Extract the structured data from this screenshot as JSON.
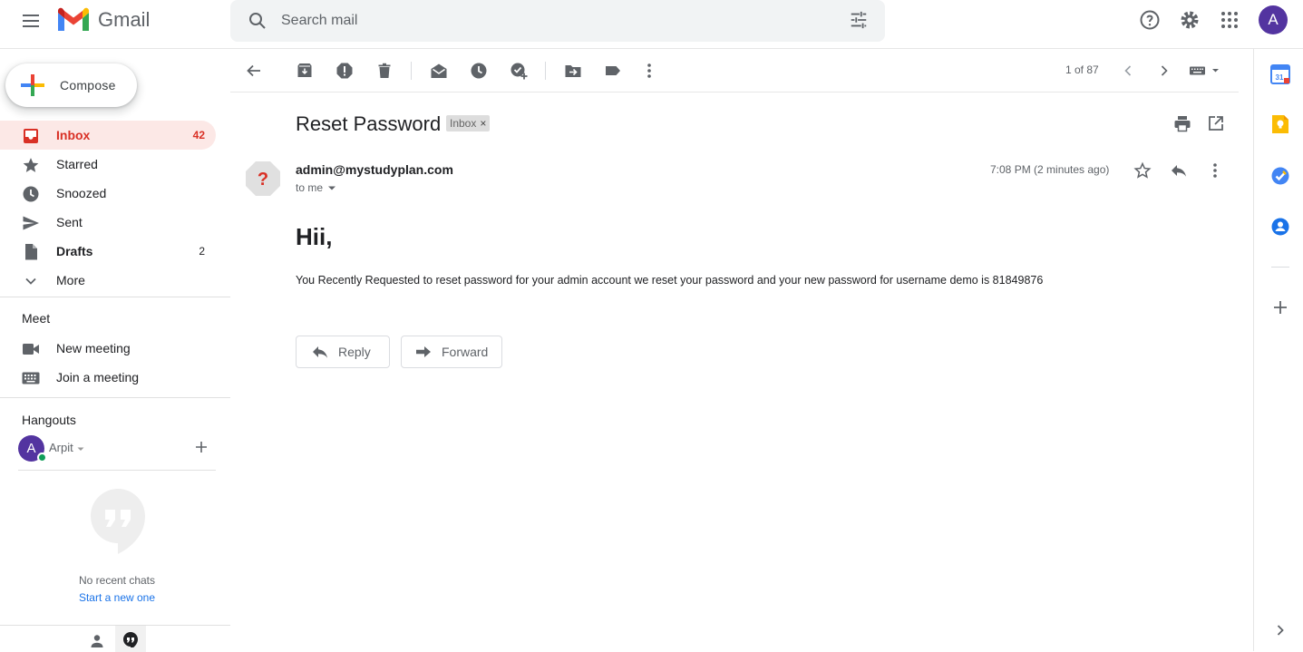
{
  "app": {
    "name": "Gmail"
  },
  "search": {
    "placeholder": "Search mail"
  },
  "account": {
    "initial": "A"
  },
  "compose": {
    "label": "Compose"
  },
  "nav": {
    "items": [
      {
        "label": "Inbox",
        "count": "42"
      },
      {
        "label": "Starred",
        "count": ""
      },
      {
        "label": "Snoozed",
        "count": ""
      },
      {
        "label": "Sent",
        "count": ""
      },
      {
        "label": "Drafts",
        "count": "2"
      },
      {
        "label": "More",
        "count": ""
      }
    ]
  },
  "meet": {
    "title": "Meet",
    "new_meeting": "New meeting",
    "join_meeting": "Join a meeting"
  },
  "hangouts": {
    "title": "Hangouts",
    "user_initial": "A",
    "user_name": "Arpit",
    "no_chats": "No recent chats",
    "start_new": "Start a new one"
  },
  "toolbar": {
    "pager": "1 of 87"
  },
  "message": {
    "subject": "Reset Password",
    "label": "Inbox",
    "label_close": "×",
    "sender": "admin@mystudyplan.com",
    "recipient": "to me",
    "time": "7:08 PM (2 minutes ago)",
    "greeting": "Hii,",
    "body": "You Recently Requested to reset password for your admin account we reset your password and your new password for username demo is 81849876",
    "reply_label": "Reply",
    "forward_label": "Forward"
  },
  "colors": {
    "inbox_active": "#d93025",
    "inbox_bg": "#fce8e6",
    "avatar": "#5334a0",
    "link": "#1a73e8"
  }
}
